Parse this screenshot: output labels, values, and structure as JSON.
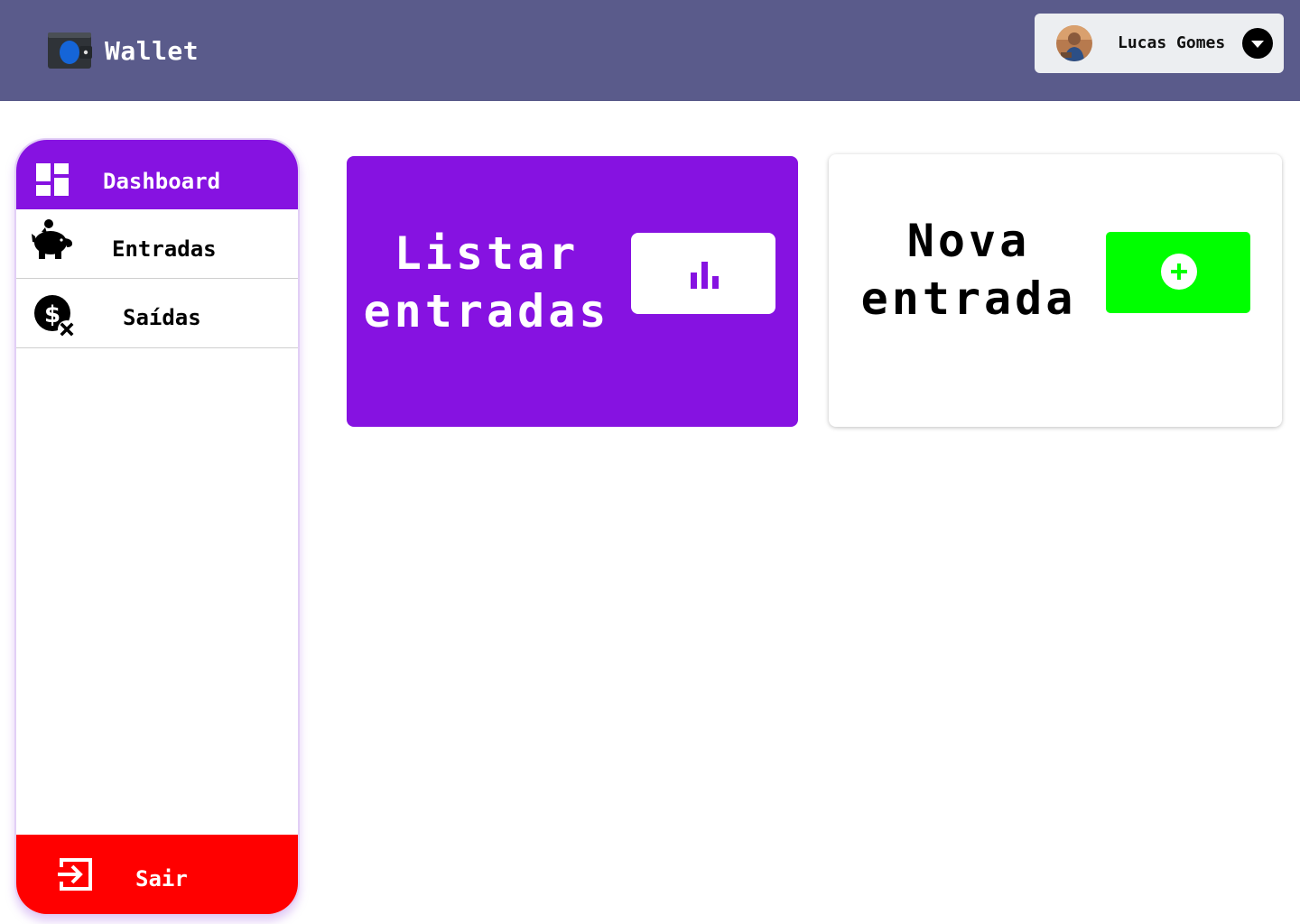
{
  "header": {
    "brand_name": "Wallet",
    "brand_icon": "wallet-icon",
    "user": {
      "name": "Lucas Gomes",
      "avatar": "user-avatar",
      "menu_icon": "caret-down-icon"
    }
  },
  "sidebar": {
    "items": [
      {
        "label": "Dashboard",
        "icon": "dashboard-icon",
        "active": true
      },
      {
        "label": "Entradas",
        "icon": "piggy-bank-icon",
        "active": false
      },
      {
        "label": "Saídas",
        "icon": "money-off-icon",
        "active": false
      }
    ],
    "logout": {
      "label": "Sair",
      "icon": "exit-icon"
    }
  },
  "cards": {
    "list_entries": {
      "title": "Listar entradas",
      "button_icon": "bar-chart-icon"
    },
    "new_entry": {
      "title": "Nova entrada",
      "button_icon": "plus-circle-icon"
    }
  },
  "colors": {
    "header_bg": "#5a5b8b",
    "accent_purple": "#8612e1",
    "success_green": "#00ff00",
    "danger_red": "#ff0000"
  }
}
